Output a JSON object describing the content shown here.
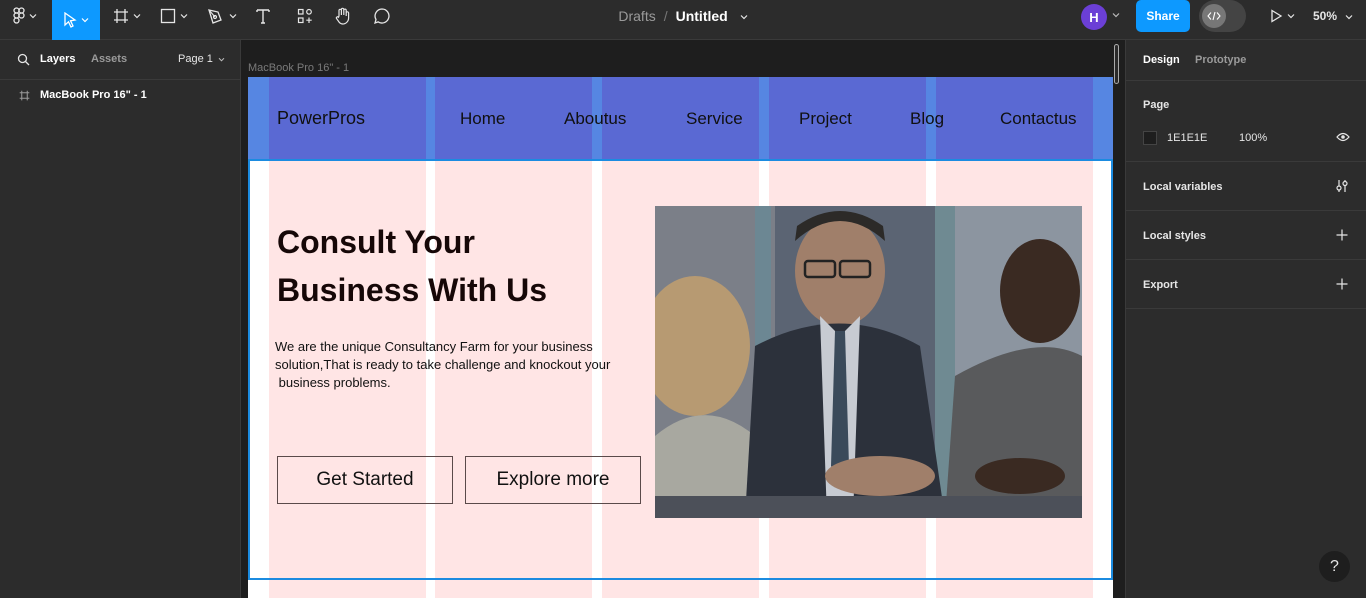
{
  "toolbar": {
    "breadcrumb_drafts": "Drafts",
    "breadcrumb_sep": "/",
    "file_title": "Untitled",
    "avatar_initial": "H",
    "share_label": "Share",
    "zoom_label": "50%",
    "tools": [
      "figma-menu-icon",
      "move-icon",
      "frame-icon",
      "rectangle-icon",
      "pen-icon",
      "text-icon",
      "resources-icon",
      "hand-icon",
      "comment-icon"
    ]
  },
  "left_panel": {
    "tab_layers": "Layers",
    "tab_assets": "Assets",
    "page_selector": "Page 1",
    "layers": [
      {
        "label": "MacBook Pro 16\" - 1"
      }
    ]
  },
  "canvas": {
    "frame_label": "MacBook Pro 16\" - 1",
    "site": {
      "logo": "PowerPros",
      "nav": [
        "Home",
        "Aboutus",
        "Service",
        "Project",
        "Blog",
        "Contactus"
      ],
      "headline_line1": "Consult Your",
      "headline_line2": "Business With Us",
      "paragraph_line1": "We are the unique Consultancy Farm for your business",
      "paragraph_line2": "solution,That is ready to take challenge and knockout your",
      "paragraph_line3": " business problems.",
      "btn_primary": "Get Started",
      "btn_secondary": "Explore more"
    }
  },
  "right_panel": {
    "tab_design": "Design",
    "tab_prototype": "Prototype",
    "page_heading": "Page",
    "page_color_hex": "1E1E1E",
    "page_opacity": "100%",
    "local_variables": "Local variables",
    "local_styles": "Local styles",
    "export": "Export"
  },
  "help_label": "?",
  "colors": {
    "accent": "#0d99ff",
    "nav_bg": "#5a69d3",
    "column_overlay": "#ffe5e5",
    "panel_bg": "#2c2c2c",
    "canvas_bg": "#1e1e1e"
  }
}
